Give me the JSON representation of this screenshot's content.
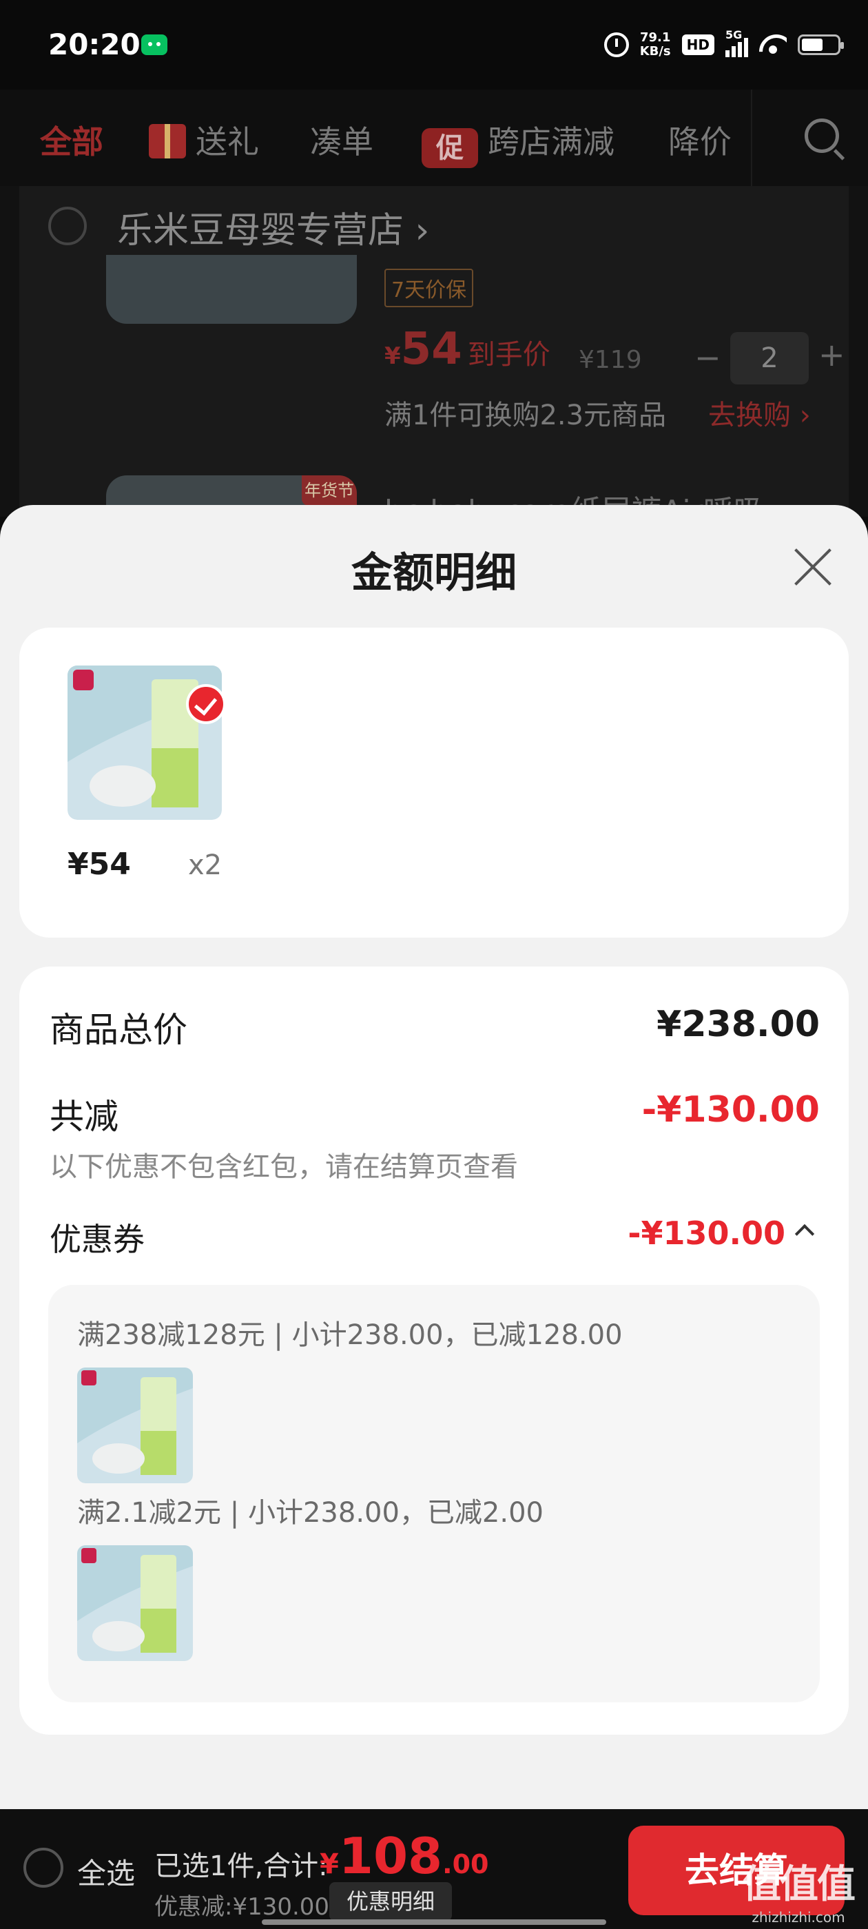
{
  "status": {
    "time": "20:20",
    "net_speed_value": "79.1",
    "net_speed_unit": "KB/s",
    "hd": "HD",
    "network": "5G",
    "battery_level": 0.6
  },
  "nav": {
    "tabs": [
      "全部",
      "送礼",
      "凑单",
      "跨店满减",
      "降价"
    ],
    "promo_badge": "促"
  },
  "store": {
    "name": "乐米豆母婴专营店",
    "chevron": "›",
    "price_guard": "7天价保",
    "final_price_symbol": "¥",
    "final_price": "54",
    "final_price_label": "到手价",
    "original_price": "¥119",
    "qty_minus": "−",
    "quantity": "2",
    "qty_plus": "+",
    "exchange_text": "满1件可换购2.3元商品",
    "exchange_link": "去换购 ›",
    "new_year_tag": "年货节",
    "next_product_title": "bc babycare纸尿裤Air呼吸"
  },
  "sheet": {
    "title": "金额明细",
    "item": {
      "price": "¥54",
      "qty": "x2"
    },
    "summary": {
      "goods_total_label": "商品总价",
      "goods_total": "¥238.00",
      "total_reduction_label": "共减",
      "total_reduction": "-¥130.00",
      "note": "以下优惠不包含红包，请在结算页查看",
      "coupon_label": "优惠券",
      "coupon_value": "-¥130.00",
      "coupons": [
        {
          "line": "满238减128元 | 小计238.00，已减128.00"
        },
        {
          "line": "满2.1减2元 | 小计238.00，已减2.00"
        }
      ]
    }
  },
  "bottom": {
    "select_all": "全选",
    "selected_total_label": "已选1件,合计:",
    "total_symbol": "¥",
    "total_int": "108",
    "total_dec": ".00",
    "discount": "优惠减:¥130.00",
    "detail_button": "优惠明细",
    "checkout_button": "去结算",
    "watermark": "值值值",
    "watermark_sub": "zhizhizhi.com"
  },
  "colors": {
    "accent_red": "#e8262e",
    "sheet_bg": "#f2f2f2",
    "dark_bg": "#0c0c0c"
  }
}
